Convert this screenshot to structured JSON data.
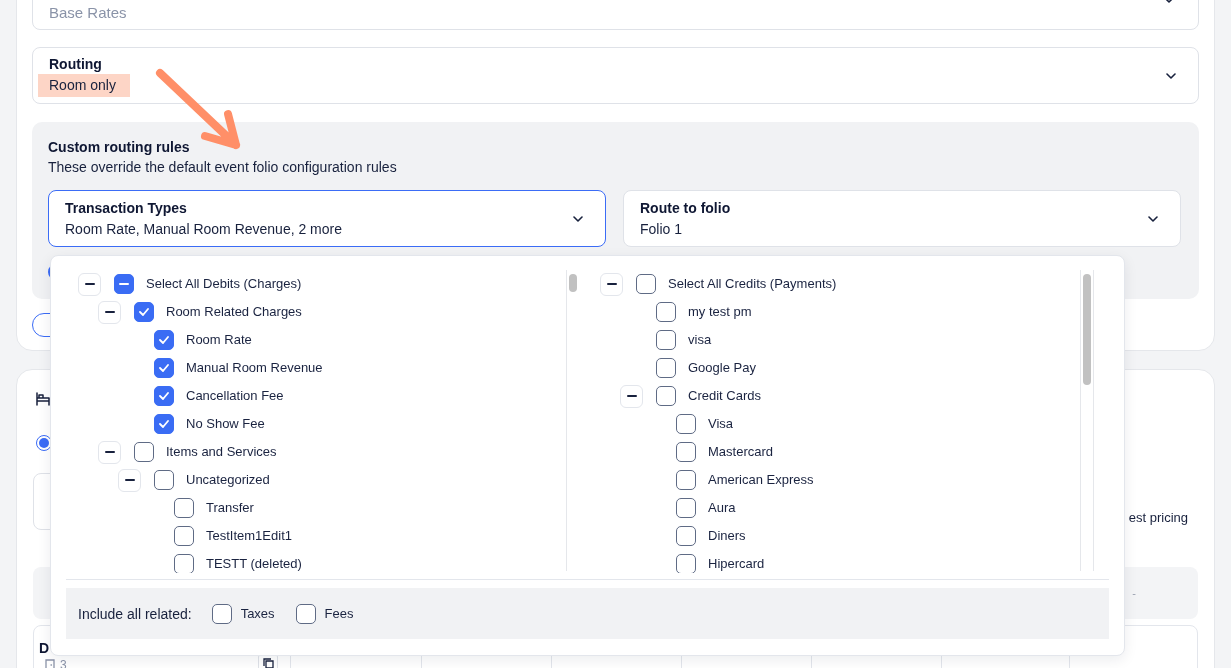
{
  "base_rates_select": {
    "placeholder": "Base Rates"
  },
  "routing_select": {
    "label": "Routing",
    "value": "Room only",
    "highlighted": true
  },
  "custom_routing_rules": {
    "title": "Custom routing rules",
    "description": "These override the default event folio configuration rules",
    "transaction_types_select": {
      "label": "Transaction Types",
      "value": "Room Rate, Manual Room Revenue, 2 more",
      "open": true
    },
    "route_to_folio_select": {
      "label": "Route to folio",
      "value": "Folio 1",
      "open": false
    }
  },
  "transaction_types_menu": {
    "debits": [
      {
        "label": "Select All Debits (Charges)",
        "kind": "group",
        "expanded": true,
        "checked": false,
        "indeterminate": true,
        "children": [
          {
            "label": "Room Related Charges",
            "kind": "group",
            "expanded": true,
            "checked": true,
            "indeterminate": false,
            "children": [
              {
                "label": "Room Rate",
                "kind": "item",
                "checked": true,
                "indeterminate": false
              },
              {
                "label": "Manual Room Revenue",
                "kind": "item",
                "checked": true,
                "indeterminate": false
              },
              {
                "label": "Cancellation Fee",
                "kind": "item",
                "checked": true,
                "indeterminate": false
              },
              {
                "label": "No Show Fee",
                "kind": "item",
                "checked": true,
                "indeterminate": false
              }
            ]
          },
          {
            "label": "Items and Services",
            "kind": "group",
            "expanded": true,
            "checked": false,
            "indeterminate": false,
            "children": [
              {
                "label": "Uncategorized",
                "kind": "group",
                "expanded": true,
                "checked": false,
                "indeterminate": false,
                "children": [
                  {
                    "label": "Transfer",
                    "kind": "item",
                    "checked": false,
                    "indeterminate": false
                  },
                  {
                    "label": "TestItem1Edit1",
                    "kind": "item",
                    "checked": false,
                    "indeterminate": false
                  },
                  {
                    "label": "TESTT (deleted)",
                    "kind": "item",
                    "checked": false,
                    "indeterminate": false
                  }
                ]
              }
            ]
          }
        ]
      }
    ],
    "credits": [
      {
        "label": "Select All Credits (Payments)",
        "kind": "group",
        "expanded": true,
        "checked": false,
        "indeterminate": false,
        "children": [
          {
            "label": "my test pm",
            "kind": "item",
            "checked": false,
            "indeterminate": false
          },
          {
            "label": "visa",
            "kind": "item",
            "checked": false,
            "indeterminate": false
          },
          {
            "label": "Google Pay",
            "kind": "item",
            "checked": false,
            "indeterminate": false
          },
          {
            "label": "Credit Cards",
            "kind": "group",
            "expanded": true,
            "checked": false,
            "indeterminate": false,
            "children": [
              {
                "label": "Visa",
                "kind": "item",
                "checked": false,
                "indeterminate": false
              },
              {
                "label": "Mastercard",
                "kind": "item",
                "checked": false,
                "indeterminate": false
              },
              {
                "label": "American Express",
                "kind": "item",
                "checked": false,
                "indeterminate": false
              },
              {
                "label": "Aura",
                "kind": "item",
                "checked": false,
                "indeterminate": false
              },
              {
                "label": "Diners",
                "kind": "item",
                "checked": false,
                "indeterminate": false
              },
              {
                "label": "Hipercard",
                "kind": "item",
                "checked": false,
                "indeterminate": false
              }
            ]
          }
        ]
      }
    ],
    "include_all_related": {
      "label": "Include all related:",
      "options": [
        {
          "label": "Taxes",
          "checked": false
        },
        {
          "label": "Fees",
          "checked": false
        }
      ]
    }
  },
  "background": {
    "pricing_radio": {
      "selected": true
    },
    "pricing_text": "est pricing",
    "summary_strip": {
      "value": "-"
    },
    "table_row": {
      "title": "D",
      "count": "3"
    }
  }
}
